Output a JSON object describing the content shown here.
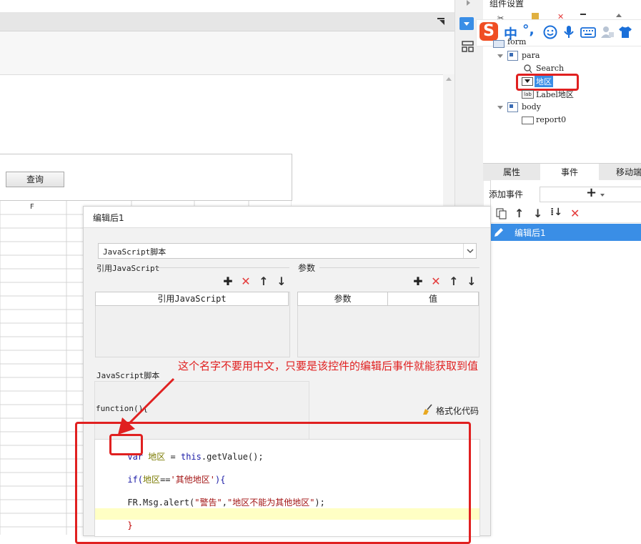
{
  "tree": {
    "panel_title": "组件设置",
    "nodes": [
      {
        "label": "form",
        "level": 0
      },
      {
        "label": "para",
        "level": 1
      },
      {
        "label": "Search",
        "level": 2
      },
      {
        "label": "地区",
        "level": 2
      },
      {
        "label": "Label地区",
        "level": 2
      },
      {
        "label": "body",
        "level": 1
      },
      {
        "label": "report0",
        "level": 2
      }
    ],
    "label_icon_text": "lab"
  },
  "ime": {
    "logo": "S",
    "mode": "中",
    "punct": "°,"
  },
  "tabs": [
    {
      "label": "属性"
    },
    {
      "label": "事件"
    },
    {
      "label": "移动端"
    }
  ],
  "events": {
    "add_label": "添加事件",
    "add_symbol": "+",
    "items": [
      {
        "label": "编辑后1"
      }
    ]
  },
  "designer": {
    "query_button": "查询",
    "column_header": "F"
  },
  "dialog": {
    "title": "编辑后1",
    "script_type": "JavaScript脚本",
    "ref_js_section": "引用JavaScript",
    "params_section": "参数",
    "ref_js_header": "引用JavaScript",
    "param_header": "参数",
    "value_header": "值",
    "js_script_label": "JavaScript脚本",
    "function_sig": "function(){",
    "format_code": "格式化代码",
    "code": {
      "l1_kw": "var",
      "l1_var": "地区",
      "l1_eq": " = ",
      "l1_this": "this",
      "l1_rest": ".getValue();",
      "l2_if": "if(",
      "l2_var": "地区",
      "l2_op": "==",
      "l2_str": "'其他地区'",
      "l2_end": "){",
      "l3_obj": "FR.Msg.alert(",
      "l3_s1": "\"警告\"",
      "l3_comma": ",",
      "l3_s2": "\"地区不能为其他地区\"",
      "l3_end": ");",
      "l4": "}"
    }
  },
  "annotation": {
    "text": "这个名字不要用中文，只要是该控件的编辑后事件就能获取到值"
  },
  "colors": {
    "accent": "#3a8ee6",
    "annotation": "#e02020"
  }
}
